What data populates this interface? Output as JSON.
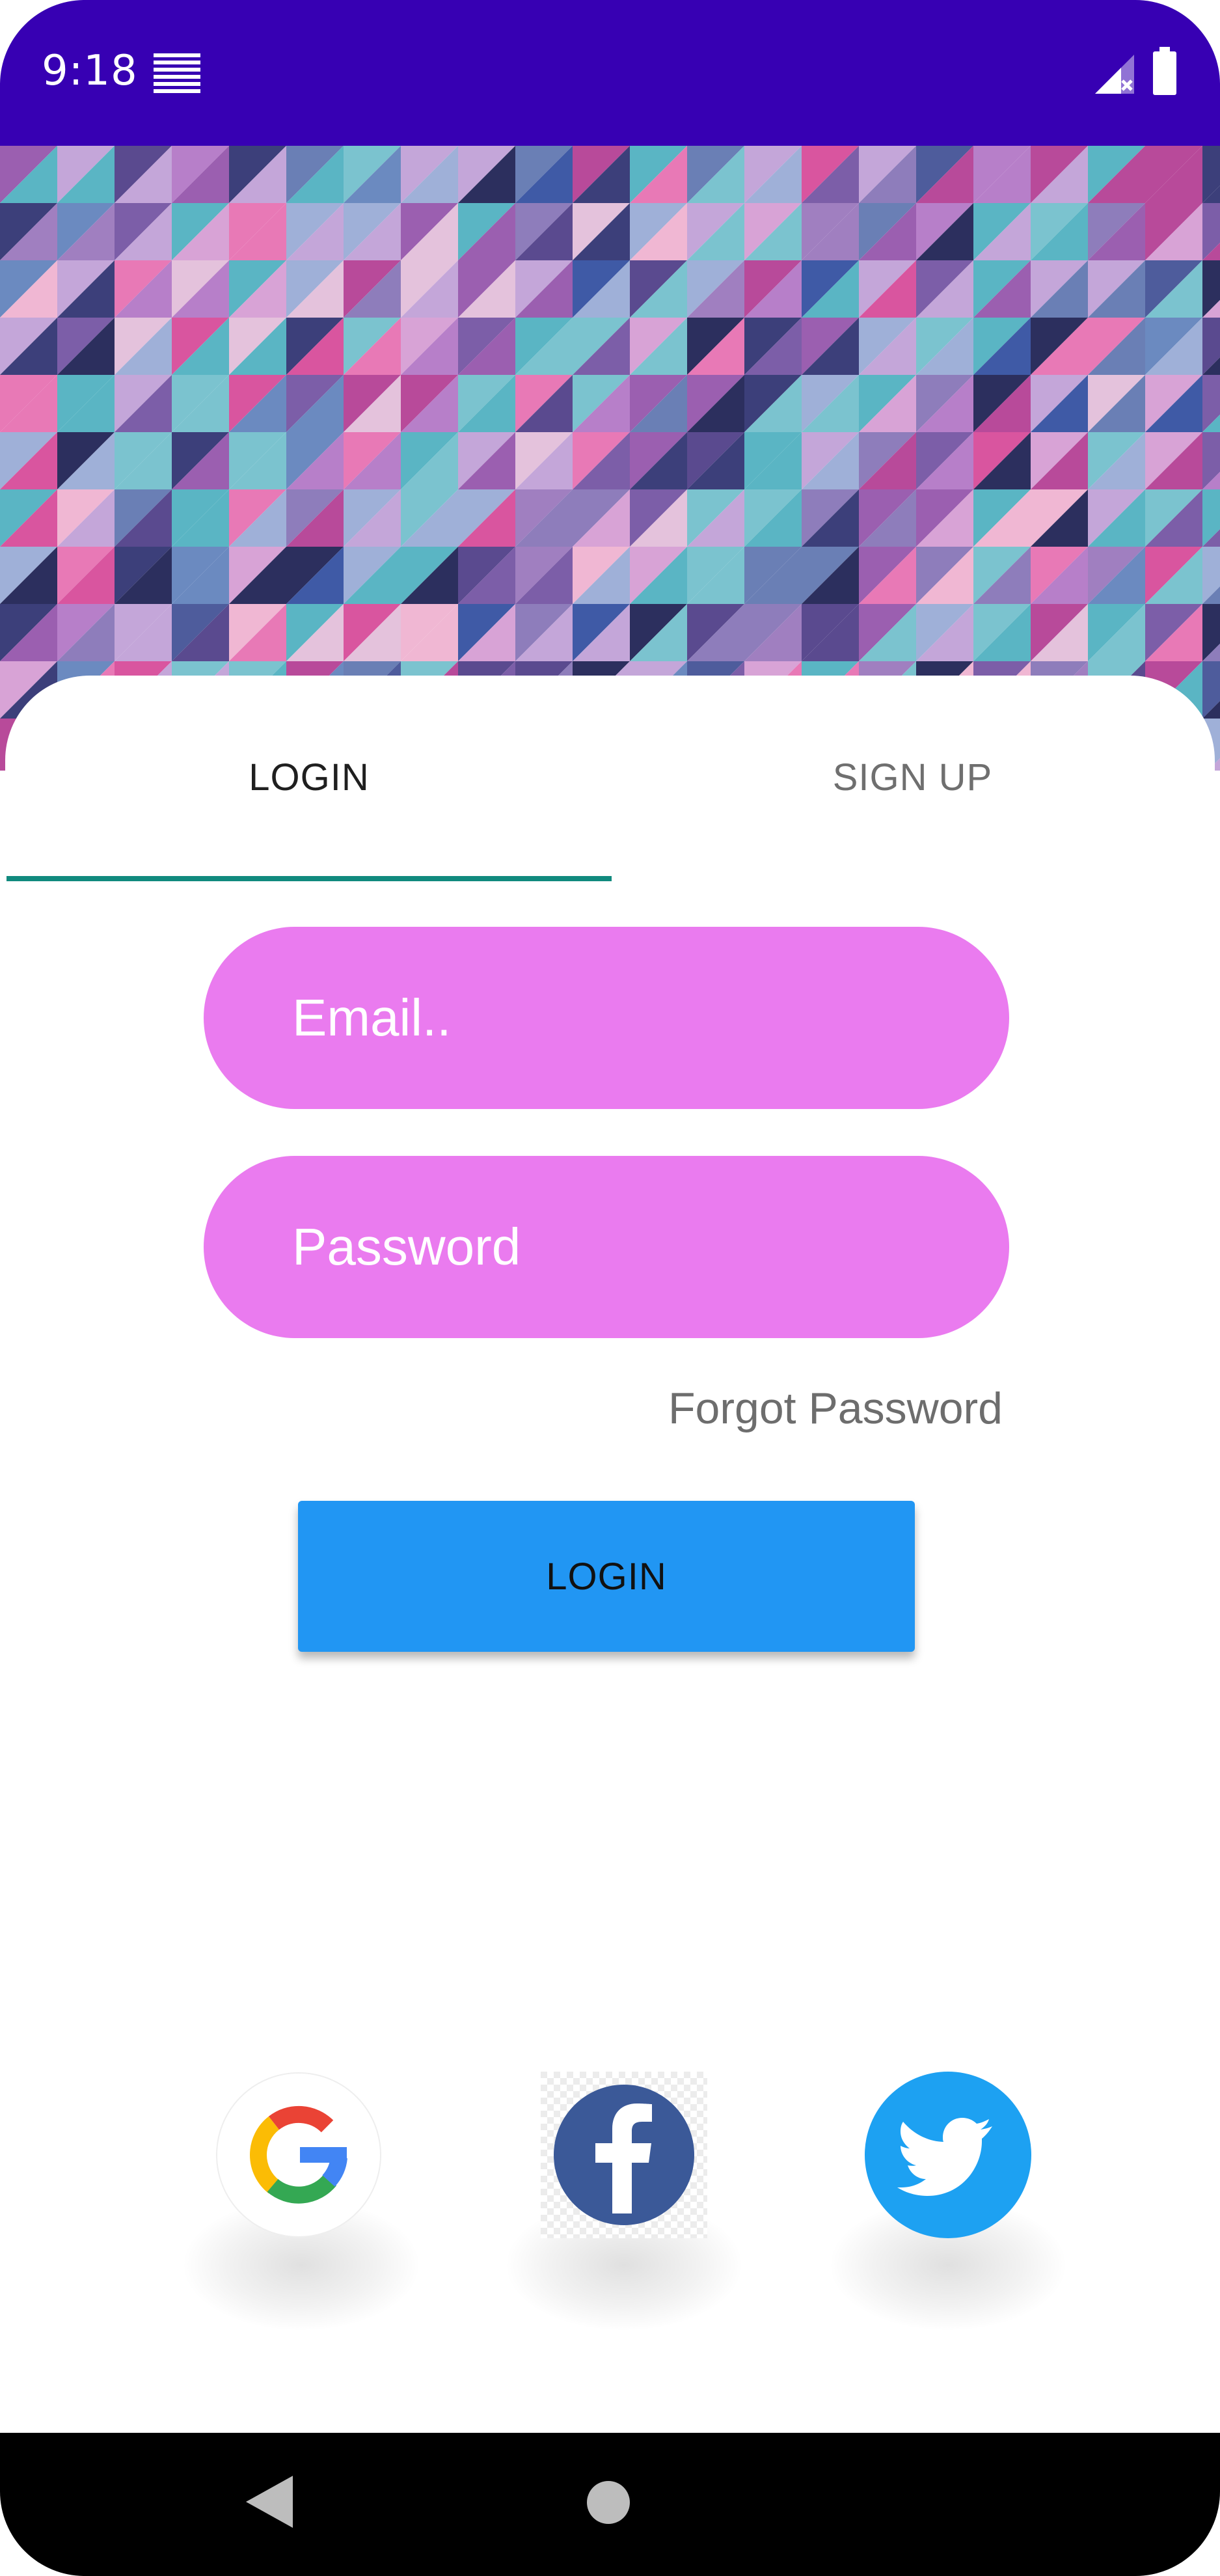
{
  "status_bar": {
    "time": "9:18",
    "background": "#3700b3",
    "icons": [
      "notification-lines-icon",
      "signal-no-data-icon",
      "battery-icon"
    ]
  },
  "tabs": [
    {
      "label": "LOGIN",
      "selected": true
    },
    {
      "label": "SIGN UP",
      "selected": false
    }
  ],
  "form": {
    "email_placeholder": "Email..",
    "email_value": "",
    "password_placeholder": "Password",
    "password_value": "",
    "forgot_password": "Forgot Password",
    "login_button": "LOGIN"
  },
  "social": [
    {
      "name": "google",
      "icon": "google-logo-icon"
    },
    {
      "name": "facebook",
      "icon": "facebook-logo-icon"
    },
    {
      "name": "twitter",
      "icon": "twitter-logo-icon"
    }
  ],
  "navigation": {
    "icons": [
      "back-icon",
      "home-icon"
    ]
  },
  "colors": {
    "status_bar": "#3700b3",
    "field_fill": "#ea7bef",
    "button_fill": "#2196f3",
    "tab_indicator": "#118a7e",
    "facebook": "#3b5998",
    "twitter": "#1da1f2"
  }
}
